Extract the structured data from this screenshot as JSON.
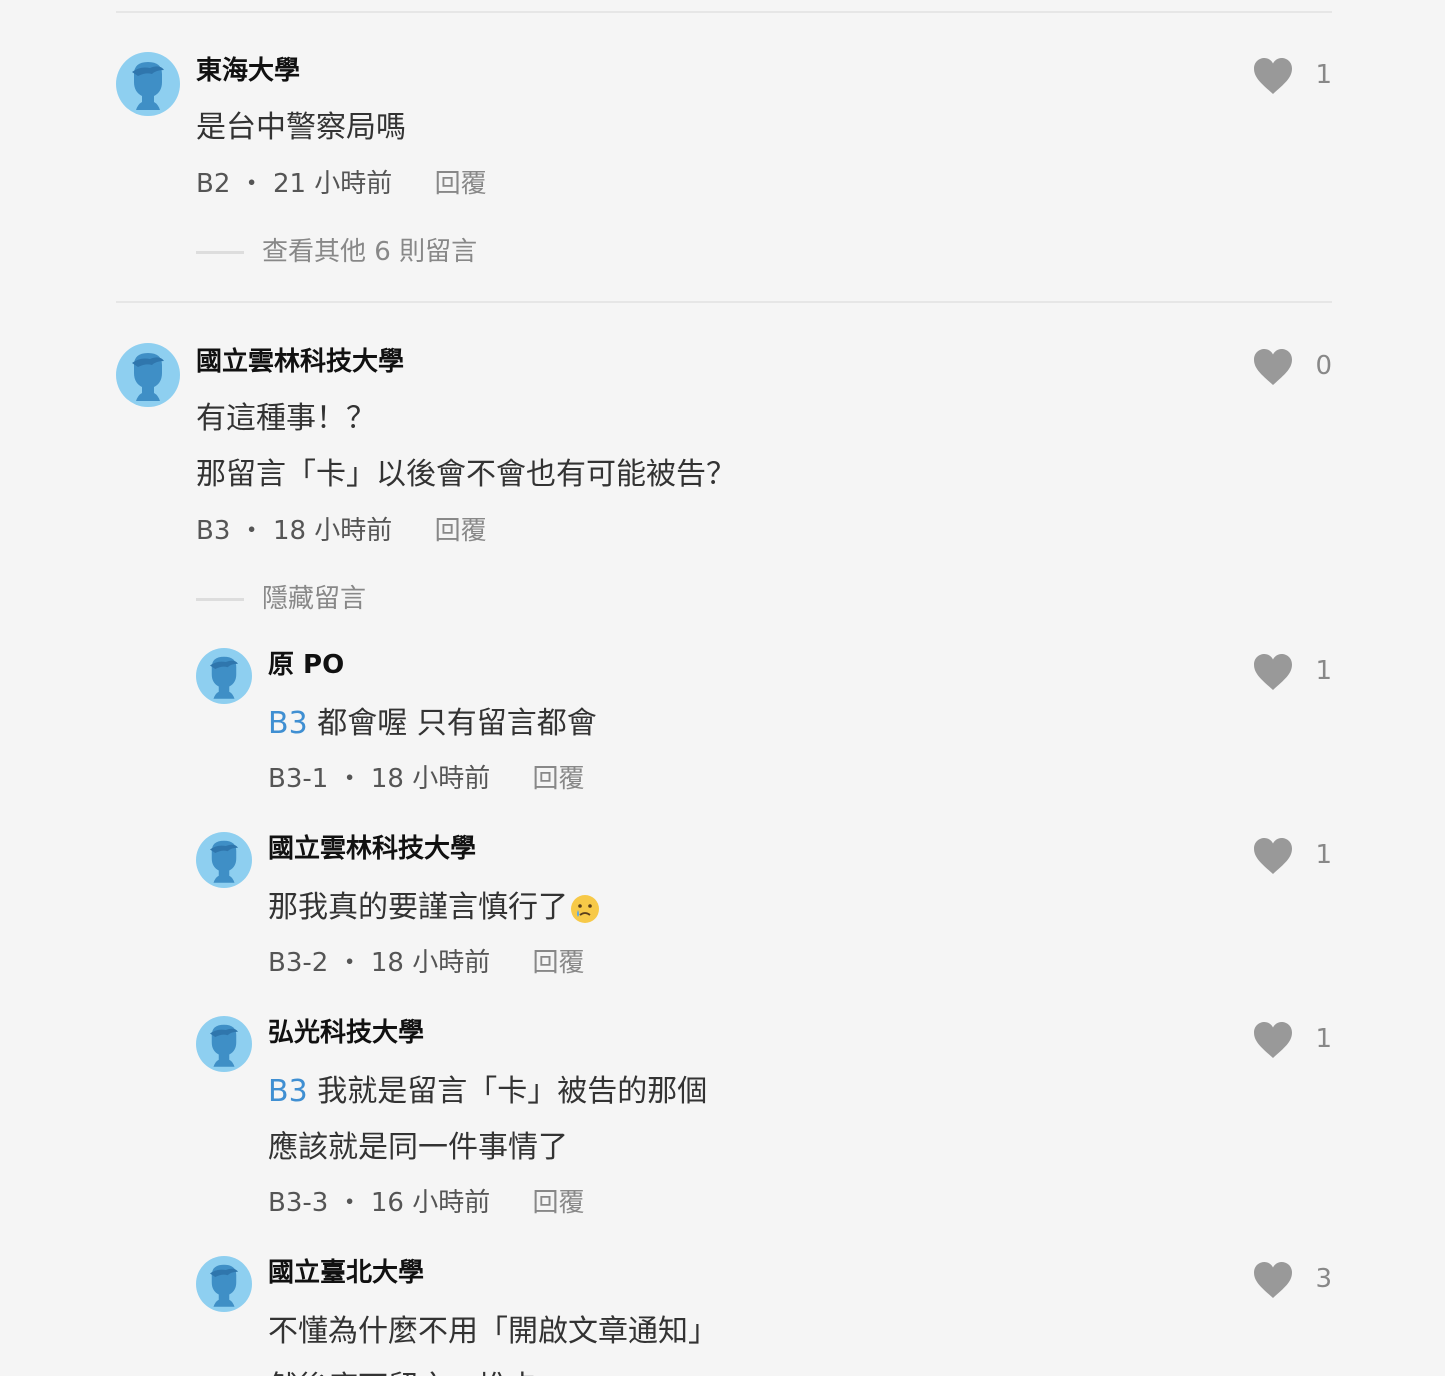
{
  "comments": [
    {
      "author": "東海大學",
      "lines": [
        "是台中警察局嗎"
      ],
      "floor": "B2",
      "time": "21 小時前",
      "reply_label": "回覆",
      "likes": "1",
      "more_label": "查看其他 6 則留言"
    },
    {
      "author": "國立雲林科技大學",
      "lines": [
        "有這種事！？",
        "那留言「卡」以後會不會也有可能被告？"
      ],
      "floor": "B3",
      "time": "18 小時前",
      "reply_label": "回覆",
      "likes": "0",
      "more_label": "隱藏留言",
      "replies": [
        {
          "author": "原 PO",
          "mention": "B3",
          "lines": [
            "都會喔 只有留言都會"
          ],
          "floor": "B3-1",
          "time": "18 小時前",
          "reply_label": "回覆",
          "likes": "1"
        },
        {
          "author": "國立雲林科技大學",
          "lines": [
            "那我真的要謹言慎行了"
          ],
          "emoji": "crying-face-emoji",
          "floor": "B3-2",
          "time": "18 小時前",
          "reply_label": "回覆",
          "likes": "1"
        },
        {
          "author": "弘光科技大學",
          "mention": "B3",
          "lines": [
            "我就是留言「卡」被告的那個",
            "應該就是同一件事情了"
          ],
          "floor": "B3-3",
          "time": "16 小時前",
          "reply_label": "回覆",
          "likes": "1"
        },
        {
          "author": "國立臺北大學",
          "lines": [
            "不懂為什麼不用「開啟文章通知」",
            "然後底下留言一堆卡"
          ],
          "likes": "3"
        }
      ]
    }
  ],
  "colors": {
    "background": "#f5f5f5",
    "avatar": "#8ecff0",
    "avatar_figure": "#3f8fc6",
    "mention": "#3f8fd2",
    "heart": "#999999"
  }
}
